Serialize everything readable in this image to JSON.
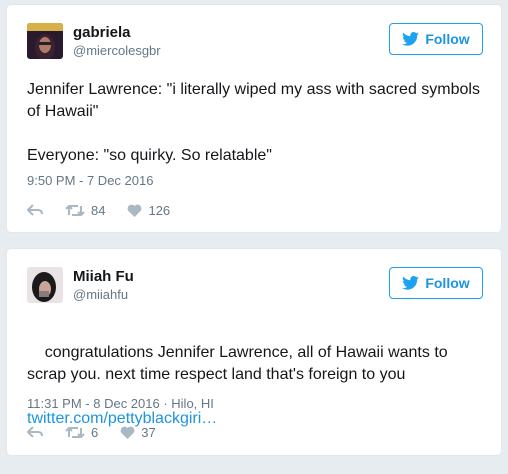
{
  "tweets": [
    {
      "name": "gabriela",
      "handle": "@miercolesgbr",
      "follow_label": "Follow",
      "text": "Jennifer Lawrence: \"i literally wiped my ass with sacred symbols of Hawaii\"\n\nEveryone: \"so quirky. So relatable\"",
      "timestamp": "9:50 PM - 7 Dec 2016",
      "retweets": "84",
      "likes": "126"
    },
    {
      "name": "Miiah Fu",
      "handle": "@miiahfu",
      "follow_label": "Follow",
      "text": "congratulations Jennifer Lawrence, all of Hawaii wants to scrap you. next time respect land that's foreign to you",
      "link": "twitter.com/pettyblackgiri…",
      "timestamp": "11:31 PM - 8 Dec 2016 · Hilo, HI",
      "retweets": "6",
      "likes": "37"
    }
  ],
  "icons": {
    "follow": "twitter-bird-icon",
    "reply": "reply-icon",
    "retweet": "retweet-icon",
    "like": "heart-icon"
  },
  "colors": {
    "accent": "#1da1f2",
    "link": "#1b95e0",
    "muted": "#657786",
    "background": "#e6ecf0"
  }
}
